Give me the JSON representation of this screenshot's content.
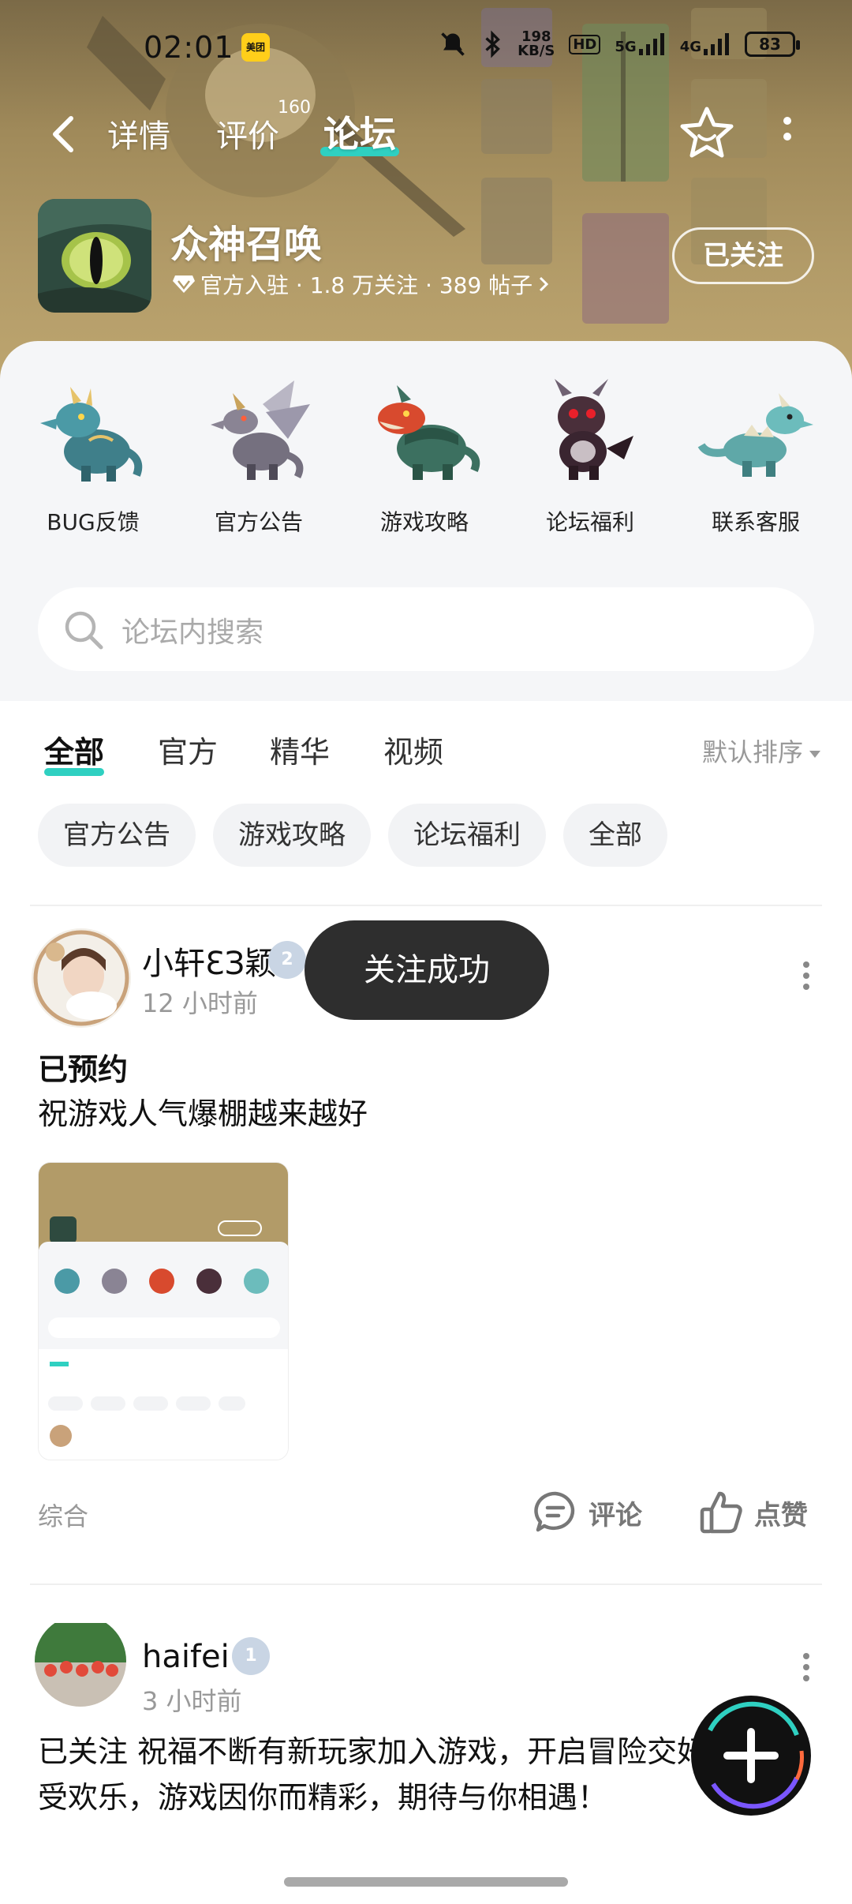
{
  "status_bar": {
    "time": "02:01",
    "app_badge": "美团",
    "net_speed_value": "198",
    "net_speed_unit": "KB/S",
    "hd_label": "HD",
    "net_5g": "5G",
    "net_4g": "4G",
    "battery": "83"
  },
  "nav": {
    "tabs": [
      {
        "label": "详情"
      },
      {
        "label": "评价"
      },
      {
        "label": "论坛"
      }
    ],
    "review_count": "160",
    "active_tab": "论坛"
  },
  "game": {
    "name": "众神召唤",
    "meta": "官方入驻 · 1.8 万关注 · 389 帖子",
    "follow_label": "已关注"
  },
  "categories": [
    {
      "label": "BUG反馈",
      "icon": "blue-dragon-icon"
    },
    {
      "label": "官方公告",
      "icon": "gray-dragon-icon"
    },
    {
      "label": "游戏攻略",
      "icon": "red-dragon-icon"
    },
    {
      "label": "论坛福利",
      "icon": "dark-dragon-icon"
    },
    {
      "label": "联系客服",
      "icon": "teal-dragon-icon"
    }
  ],
  "search": {
    "placeholder": "论坛内搜索"
  },
  "feed_tabs": [
    {
      "label": "全部"
    },
    {
      "label": "官方"
    },
    {
      "label": "精华"
    },
    {
      "label": "视频"
    }
  ],
  "sort_label": "默认排序",
  "chips": [
    {
      "label": "官方公告"
    },
    {
      "label": "游戏攻略"
    },
    {
      "label": "论坛福利"
    },
    {
      "label": "全部"
    }
  ],
  "posts": [
    {
      "username": "小轩ƐЗ颖",
      "level": "2",
      "time": "12 小时前",
      "title": "已预约",
      "body": "祝游戏人气爆棚越来越好",
      "tag": "综合",
      "comment_label": "评论",
      "like_label": "点赞"
    },
    {
      "username": "haifei",
      "level": "1",
      "time": "3 小时前",
      "body": "已关注  祝福不断有新玩家加入游戏，开启冒险交好友，感受欢乐，游戏因你而精彩，期待与你相遇！"
    }
  ],
  "toast": "关注成功",
  "colors": {
    "accent": "#2fd0c1",
    "header_bg": "#b29b68",
    "toast_bg": "#2e2e2e"
  }
}
